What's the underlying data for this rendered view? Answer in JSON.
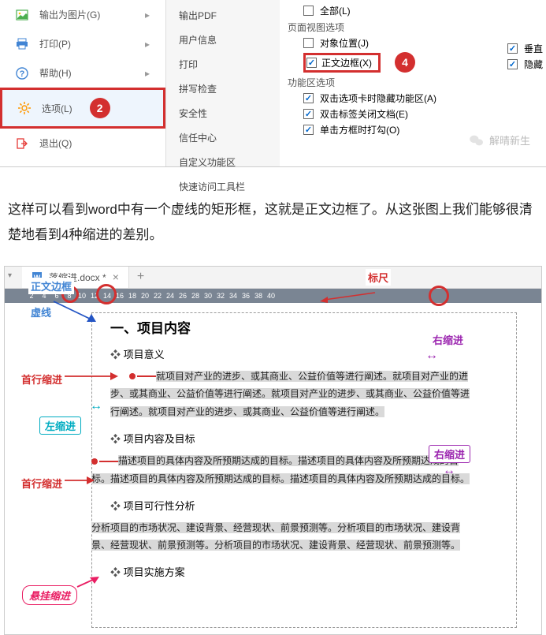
{
  "backstage_menu": {
    "export_image": "输出为图片(G)",
    "print": "打印(P)",
    "help": "帮助(H)",
    "options": "选项(L)",
    "exit": "退出(Q)",
    "badge_options": "2"
  },
  "mid_menu": {
    "items": [
      "输出PDF",
      "用户信息",
      "打印",
      "拼写检查",
      "安全性",
      "信任中心",
      "自定义功能区",
      "快速访问工具栏"
    ]
  },
  "options_panel": {
    "all": "全部(L)",
    "group_pageview": "页面视图选项",
    "obj_position": "对象位置(J)",
    "text_frame": "正文边框(X)",
    "badge_frame": "4",
    "group_ribbon": "功能区选项",
    "dbl_tab_hide": "双击选项卡时隐藏功能区(A)",
    "dbl_label_close": "双击标签关闭文档(E)",
    "single_checkbox": "单击方框时打勾(O)",
    "right_vert": "垂直",
    "right_hide": "隐藏",
    "watermark": "解晴新生"
  },
  "explain": "这样可以看到word中有一个虚线的矩形框，这就是正文边框了。从这张图上我们能够很清楚地看到4种缩进的差别。",
  "doc_tab": {
    "filename": "落缩进.docx *"
  },
  "ruler": {
    "marks": [
      "2",
      "4",
      "6",
      "8",
      "10",
      "12",
      "14",
      "16",
      "18",
      "20",
      "22",
      "24",
      "26",
      "28",
      "30",
      "32",
      "34",
      "36",
      "38",
      "40"
    ]
  },
  "annotations": {
    "ruler_label": "标尺",
    "text_frame": "正文边框",
    "dotted": "虚线",
    "first_indent": "首行缩进",
    "left_indent": "左缩进",
    "right_indent": "右缩进",
    "hanging_indent": "悬挂缩进"
  },
  "document": {
    "h1": "一、项目内容",
    "h2_1": "项目意义",
    "p1": "就项目对产业的进步、或其商业、公益价值等进行阐述。就项目对产业的进步、或其商业、公益价值等进行阐述。就项目对产业的进步、或其商业、公益价值等进行阐述。就项目对产业的进步、或其商业、公益价值等进行阐述。",
    "h2_2": "项目内容及目标",
    "p2": "描述项目的具体内容及所预期达成的目标。描述项目的具体内容及所预期达成的目标。描述项目的具体内容及所预期达成的目标。描述项目的具体内容及所预期达成的目标。",
    "h2_3": "项目可行性分析",
    "p3": "分析项目的市场状况、建设背景、经营现状、前景预测等。分析项目的市场状况、建设背景、经营现状、前景预测等。分析项目的市场状况、建设背景、经营现状、前景预测等。",
    "h2_4": "项目实施方案"
  }
}
